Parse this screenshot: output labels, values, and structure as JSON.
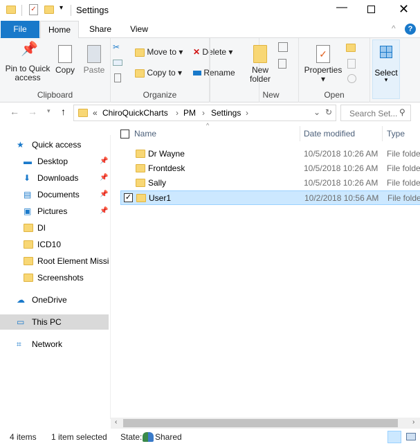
{
  "window": {
    "title": "Settings"
  },
  "tabs": [
    {
      "label": "File"
    },
    {
      "label": "Home"
    },
    {
      "label": "Share"
    },
    {
      "label": "View"
    }
  ],
  "ribbon": {
    "clipboard": {
      "label": "Clipboard",
      "pin": "Pin to Quick access",
      "pin1": "Pin to Quick",
      "pin2": "access",
      "copy": "Copy",
      "paste": "Paste"
    },
    "organize": {
      "label": "Organize",
      "move_to": "Move to",
      "copy_to": "Copy to",
      "delete": "Delete",
      "rename": "Rename"
    },
    "new": {
      "label": "New",
      "new_folder1": "New",
      "new_folder2": "folder"
    },
    "open": {
      "label": "Open",
      "properties": "Properties"
    },
    "select": {
      "label": "Select"
    }
  },
  "address": {
    "crumbs": [
      "ChiroQuickCharts",
      "PM",
      "Settings"
    ],
    "overflow": "«",
    "search_placeholder": "Search Set..."
  },
  "nav": [
    {
      "label": "Quick access",
      "icon": "star-icon"
    },
    {
      "label": "Desktop",
      "icon": "desktop-icon",
      "pinned": true
    },
    {
      "label": "Downloads",
      "icon": "download-icon",
      "pinned": true
    },
    {
      "label": "Documents",
      "icon": "documents-icon",
      "pinned": true
    },
    {
      "label": "Pictures",
      "icon": "pictures-icon",
      "pinned": true
    },
    {
      "label": "DI",
      "icon": "folder-icon"
    },
    {
      "label": "ICD10",
      "icon": "folder-icon"
    },
    {
      "label": "Root Element Missin",
      "icon": "folder-icon"
    },
    {
      "label": "Screenshots",
      "icon": "folder-icon"
    },
    {
      "label": "OneDrive",
      "icon": "cloud-icon"
    },
    {
      "label": "This PC",
      "icon": "pc-icon",
      "selected": true
    },
    {
      "label": "Network",
      "icon": "network-icon"
    }
  ],
  "columns": {
    "name": "Name",
    "date": "Date modified",
    "type": "Type"
  },
  "files": [
    {
      "name": "Dr Wayne",
      "date": "10/5/2018 10:26 AM",
      "type": "File folder"
    },
    {
      "name": "Frontdesk",
      "date": "10/5/2018 10:26 AM",
      "type": "File folder"
    },
    {
      "name": "Sally",
      "date": "10/5/2018 10:26 AM",
      "type": "File folder"
    },
    {
      "name": "User1",
      "date": "10/2/2018 10:56 AM",
      "type": "File folder",
      "selected": true
    }
  ],
  "status": {
    "count": "4 items",
    "selected": "1 item selected",
    "state_label": "State:",
    "state": "Shared"
  },
  "colors": {
    "accent": "#1979ca",
    "selection": "#cce8ff"
  }
}
